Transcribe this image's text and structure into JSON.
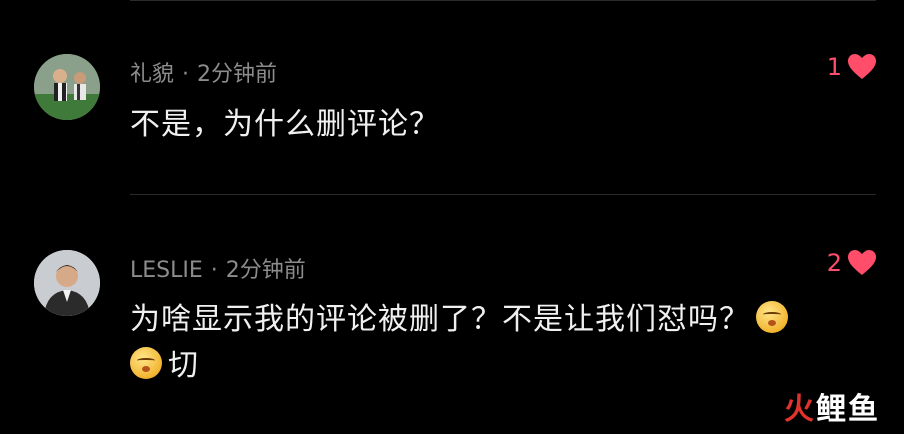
{
  "comments": [
    {
      "author": "礼貌",
      "separator": "·",
      "time": "2分钟前",
      "text": "不是，为什么删评论？",
      "likes": "1"
    },
    {
      "author": "LESLIE",
      "separator": "·",
      "time": "2分钟前",
      "text_line1": "为啥显示我的评论被删了？不是让我们怼吗？",
      "text_line2": "切",
      "likes": "2"
    }
  ],
  "watermark": {
    "part1": "火",
    "part2": "鲤鱼"
  },
  "colors": {
    "like": "#ff4d6a",
    "meta": "#8c8c8c",
    "background": "#000000"
  },
  "icons": [
    "heart-icon",
    "smirk-emoji-icon"
  ]
}
